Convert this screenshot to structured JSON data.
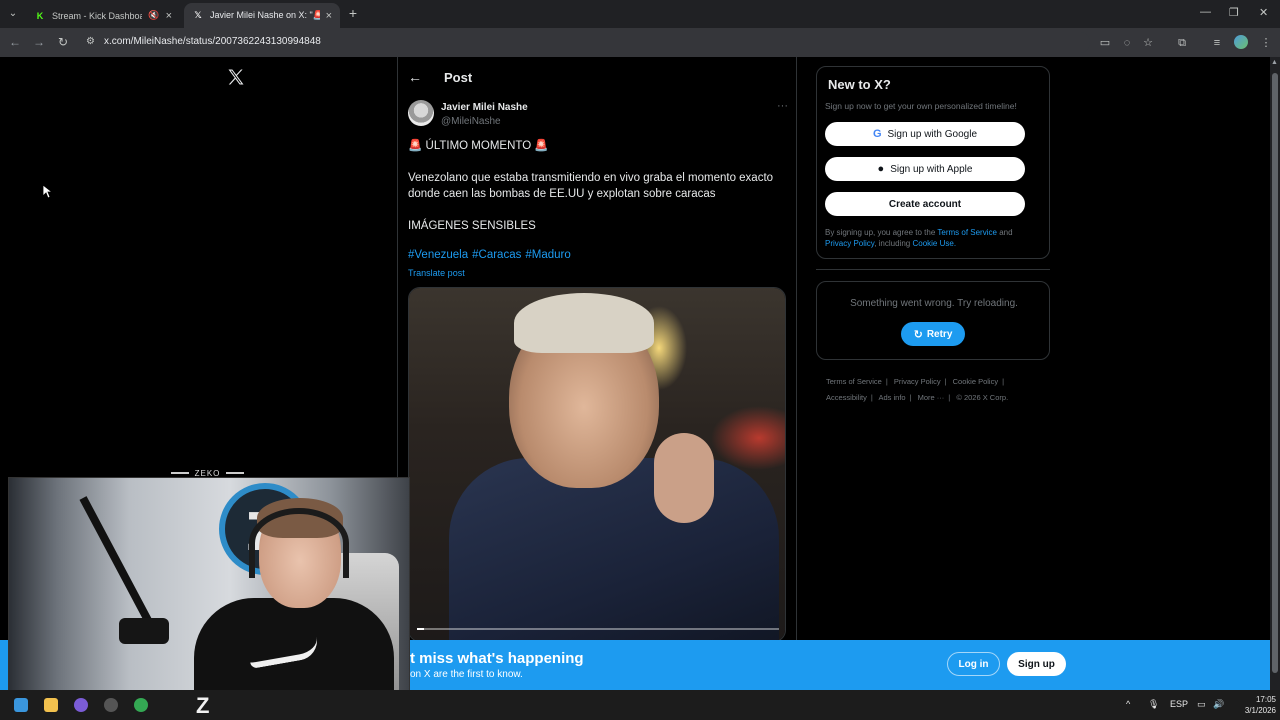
{
  "browser": {
    "tabs": [
      {
        "title": "Stream - Kick Dashboard",
        "favicon": "kick-icon",
        "active": false
      },
      {
        "title": "Javier Milei Nashe on X: \"🚨 Ú",
        "favicon": "x-icon",
        "active": true
      }
    ],
    "url": "x.com/MileiNashe/status/2007362243130994848"
  },
  "sidebar_left": {
    "logo": "x-logo"
  },
  "timeline": {
    "header_title": "Post",
    "author_name": "Javier Milei Nashe",
    "author_handle": "@MileiNashe",
    "line1": "🚨 ÚLTIMO MOMENTO 🚨",
    "line2": "Venezolano que estaba transmitiendo en vivo graba el momento exacto donde caen las bombas de EE.UU y explotan sobre caracas",
    "line3": "IMÁGENES SENSIBLES",
    "hashtags": [
      "#Venezuela",
      "#Caracas",
      "#Maduro"
    ],
    "translate": "Translate post",
    "video_progress": 0.02
  },
  "right": {
    "new_title": "New to X?",
    "new_sub": "Sign up now to get your own personalized timeline!",
    "google_label": "Sign up with Google",
    "apple_label": "Sign up with Apple",
    "create_label": "Create account",
    "legal_prefix": "By signing up, you agree to the",
    "terms": "Terms of Service",
    "and": "and",
    "privacy": "Privacy Policy",
    "including": ", including",
    "cookie": "Cookie Use.",
    "error_msg": "Something went wrong. Try reloading.",
    "retry_label": "Retry",
    "footer": [
      "Terms of Service",
      "Privacy Policy",
      "Cookie Policy",
      "Accessibility",
      "Ads info",
      "More ···",
      "© 2026 X Corp."
    ]
  },
  "banner": {
    "title": "t miss what's happening",
    "sub": "on X are the first to know.",
    "login": "Log in",
    "signup": "Sign up"
  },
  "webcam": {
    "tag": "ZEKO"
  },
  "taskbar": {
    "lang": "ESP",
    "time": "17:05",
    "date": "3/1/2026"
  },
  "colors": {
    "accent": "#1d9bf0",
    "background": "#000000",
    "text": "#e7e9ea",
    "muted": "#71767b"
  }
}
